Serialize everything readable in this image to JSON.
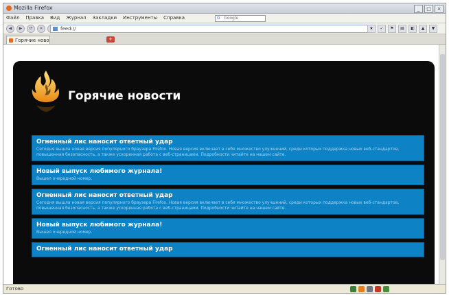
{
  "window": {
    "title": "Mozilla Firefox",
    "controls": [
      "_",
      "□",
      "×"
    ]
  },
  "menu": {
    "items": [
      "Файл",
      "Правка",
      "Вид",
      "Журнал",
      "Закладки",
      "Инструменты",
      "Справка"
    ],
    "search_placeholder": "Google"
  },
  "nav": {
    "url": "feed://",
    "buttons": [
      "◀",
      "▶",
      "⟳",
      "✕",
      "⌂"
    ],
    "tool_icons": [
      "★",
      "✓",
      "⚑",
      "▤",
      "◧",
      "▲",
      "▼"
    ]
  },
  "tabs": [
    {
      "label": "Горячие новости"
    }
  ],
  "page": {
    "site_title": "Горячие новости",
    "news": [
      {
        "headline": "Огненный лис наносит ответный удар",
        "text": "Сегодня вышла новая версия популярного браузера Firefox. Новая версия включает в себя множество улучшений, среди которых поддержка новых веб-стандартов, повышенная безопасность, а также ускоренная работа с веб-страницами. Подробности читайте на нашем сайте."
      },
      {
        "headline": "Новый выпуск любимого журнала!",
        "text": "Вышел очередной номер."
      },
      {
        "headline": "Огненный лис наносит ответный удар",
        "text": "Сегодня вышла новая версия популярного браузера Firefox. Новая версия включает в себя множество улучшений, среди которых поддержка новых веб-стандартов, повышенная безопасность, а также ускоренная работа с веб-страницами. Подробности читайте на нашем сайте."
      },
      {
        "headline": "Новый выпуск любимого журнала!",
        "text": "Вышел очередной номер."
      },
      {
        "headline": "Огненный лис наносит ответный удар",
        "text": ""
      }
    ]
  },
  "status": {
    "text": "Готово",
    "icons": [
      "shield-icon",
      "rss-icon",
      "pencil-icon",
      "block-icon",
      "addon-icon"
    ]
  },
  "colors": {
    "page_background": "#0b0b0b",
    "news_item": "#0d82c4",
    "headline": "#ffffff",
    "news_text": "#a8d8f6"
  }
}
